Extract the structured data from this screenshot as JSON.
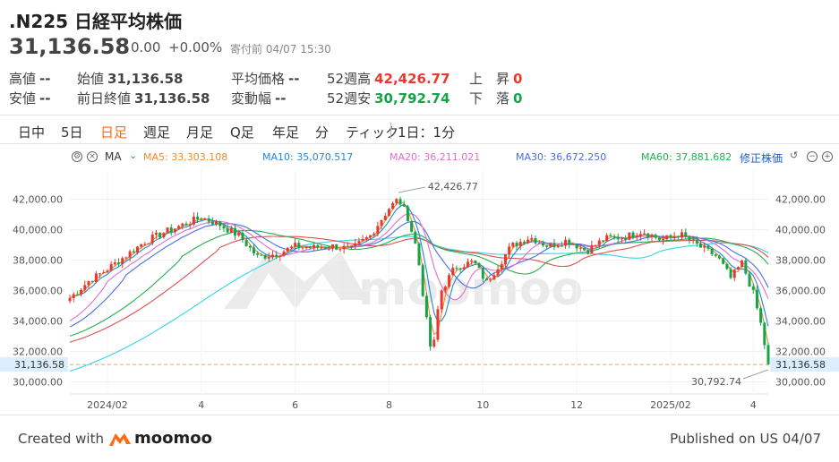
{
  "header": {
    "symbol_name": ".N225 日経平均株価",
    "price": "31,136.58",
    "change": "0.00",
    "change_pct": "+0.00%",
    "status": "寄付前 04/07 15:30"
  },
  "stats": {
    "high": {
      "label": "高値",
      "value": "--"
    },
    "low": {
      "label": "安値",
      "value": "--"
    },
    "open": {
      "label": "始値",
      "value": "31,136.58"
    },
    "prev_close": {
      "label": "前日終値",
      "value": "31,136.58"
    },
    "avg_price": {
      "label": "平均価格",
      "value": "--"
    },
    "change_range": {
      "label": "変動幅",
      "value": "--"
    },
    "week52_high": {
      "label": "52週高",
      "value": "42,426.77"
    },
    "week52_low": {
      "label": "52週安",
      "value": "30,792.74"
    },
    "up": {
      "label": "上　昇",
      "value": "0"
    },
    "down": {
      "label": "下　落",
      "value": "0"
    }
  },
  "tabs": [
    "日中",
    "5日",
    "日足",
    "週足",
    "月足",
    "Q足",
    "年足",
    "分",
    "ティック",
    "1日：1分"
  ],
  "active_tab": "日足",
  "ma_bar": {
    "label": "MA",
    "ma5": "MA5:  33,303.108",
    "ma10": "MA10:  35,070.517",
    "ma20": "MA20:  36,211.021",
    "ma30": "MA30:  36,672.250",
    "ma60": "MA60:  37,881.682",
    "adjust": "修正株価"
  },
  "colors": {
    "up": "#e8392f",
    "down": "#17a34a",
    "ma5": "#f08b2d",
    "ma10": "#1f8ad6",
    "ma20": "#e06fd0",
    "ma30": "#4a6ee0",
    "ma60": "#23b04e",
    "ma_long_red": "#e05050",
    "ma_long_cyan": "#30d6e6",
    "last_price_line": "#f0a050",
    "active_tab": "#ff6a13"
  },
  "chart_data": {
    "type": "candlestick",
    "y_ticks": [
      "42,000.00",
      "40,000.00",
      "38,000.00",
      "36,000.00",
      "34,000.00",
      "32,000.00",
      "30,000.00"
    ],
    "y_tick_values": [
      42000,
      40000,
      38000,
      36000,
      34000,
      32000,
      30000
    ],
    "ylim": [
      29200,
      43900
    ],
    "x_ticks": [
      "2024/02",
      "4",
      "6",
      "8",
      "10",
      "12",
      "2025/02",
      "4"
    ],
    "last_price": 31136.58,
    "last_price_label": "31,136.58",
    "high_annotation": "42,426.77",
    "low_annotation": "30,792.74",
    "high_value": 42426.77,
    "low_value": 30792.74,
    "series_close_points": [
      [
        0,
        35500
      ],
      [
        10,
        36600
      ],
      [
        20,
        37400
      ],
      [
        30,
        38300
      ],
      [
        40,
        39200
      ],
      [
        50,
        39800
      ],
      [
        60,
        40300
      ],
      [
        70,
        40800
      ],
      [
        80,
        40300
      ],
      [
        90,
        39600
      ],
      [
        100,
        38200
      ],
      [
        110,
        38400
      ],
      [
        120,
        38900
      ],
      [
        130,
        38800
      ],
      [
        140,
        38900
      ],
      [
        150,
        38700
      ],
      [
        160,
        39600
      ],
      [
        170,
        41400
      ],
      [
        175,
        42000
      ],
      [
        180,
        40800
      ],
      [
        185,
        38600
      ],
      [
        190,
        34000
      ],
      [
        193,
        31500
      ],
      [
        197,
        35800
      ],
      [
        205,
        37500
      ],
      [
        215,
        37900
      ],
      [
        222,
        36500
      ],
      [
        228,
        37600
      ],
      [
        235,
        38900
      ],
      [
        245,
        39500
      ],
      [
        255,
        38900
      ],
      [
        265,
        39300
      ],
      [
        275,
        38600
      ],
      [
        285,
        39400
      ],
      [
        295,
        39500
      ],
      [
        305,
        39900
      ],
      [
        315,
        39300
      ],
      [
        325,
        39700
      ],
      [
        335,
        38900
      ],
      [
        345,
        38200
      ],
      [
        352,
        36800
      ],
      [
        358,
        37800
      ],
      [
        364,
        35800
      ],
      [
        368,
        33800
      ],
      [
        372,
        31136
      ]
    ],
    "x_index_range": [
      0,
      372
    ],
    "x_tick_index": [
      20,
      70,
      120,
      170,
      220,
      270,
      320,
      364
    ]
  },
  "footer": {
    "created_with": "Created with",
    "brand": "moomoo",
    "published": "Published on US 04/07"
  }
}
